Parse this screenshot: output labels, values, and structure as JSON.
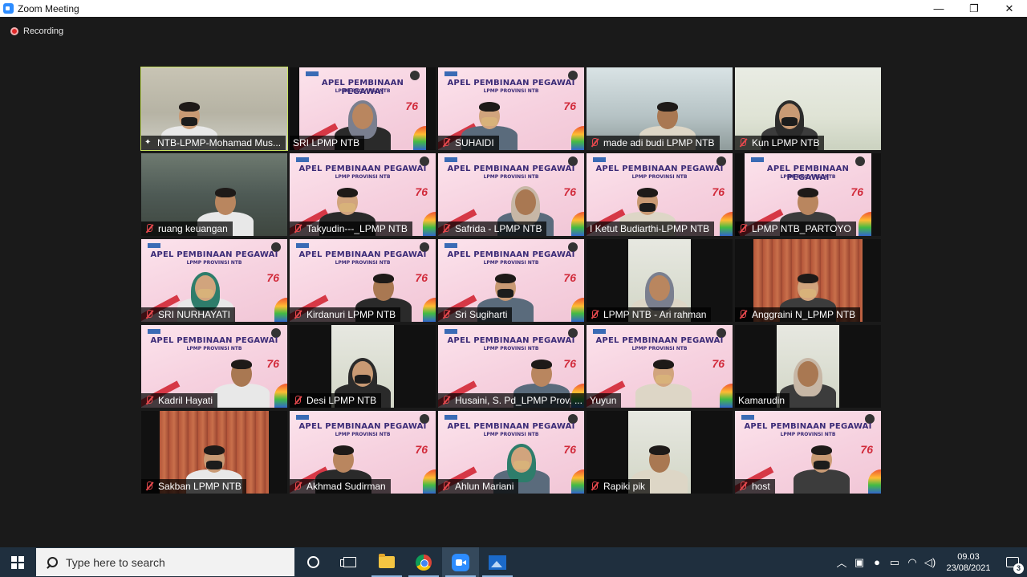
{
  "window": {
    "title": "Zoom Meeting",
    "controls": {
      "minimize": "—",
      "restore": "❐",
      "close": "✕"
    }
  },
  "recording": {
    "label": "Recording"
  },
  "participants": [
    {
      "name": "NTB-LPMP-Mohamad Mus...",
      "muted": false,
      "pinned": true,
      "active": true,
      "bg": "room"
    },
    {
      "name": "SRI LPMP NTB",
      "muted": false,
      "bg": "banner-narrow"
    },
    {
      "name": "SUHAIDI",
      "muted": true,
      "bg": "banner"
    },
    {
      "name": "made adi budi LPMP NTB",
      "muted": true,
      "bg": "window"
    },
    {
      "name": "Kun LPMP NTB",
      "muted": true,
      "bg": "wall-green"
    },
    {
      "name": "ruang keuangan",
      "muted": true,
      "bg": "dark-room"
    },
    {
      "name": "Takyudin---_LPMP NTB",
      "muted": true,
      "bg": "banner"
    },
    {
      "name": "Safrida - LPMP NTB",
      "muted": true,
      "bg": "banner"
    },
    {
      "name": "I Ketut Budiarthi-LPMP NTB",
      "muted": false,
      "bg": "banner"
    },
    {
      "name": "LPMP NTB_PARTOYO",
      "muted": true,
      "bg": "banner-narrow"
    },
    {
      "name": "SRI NURHAYATI",
      "muted": true,
      "bg": "banner"
    },
    {
      "name": "Kirdanuri LPMP NTB",
      "muted": true,
      "bg": "banner"
    },
    {
      "name": "Sri Sugiharti",
      "muted": true,
      "bg": "banner"
    },
    {
      "name": "LPMP NTB - Ari rahman",
      "muted": true,
      "bg": "narrow"
    },
    {
      "name": "Anggraini N_LPMP NTB",
      "muted": true,
      "bg": "curtain-narrow"
    },
    {
      "name": "Kadril Hayati",
      "muted": true,
      "bg": "banner"
    },
    {
      "name": "Desi LPMP NTB",
      "muted": true,
      "bg": "narrow"
    },
    {
      "name": "Husaini, S. Pd_LPMP Prov. ...",
      "muted": true,
      "bg": "banner"
    },
    {
      "name": "Yuyun",
      "muted": false,
      "bg": "banner"
    },
    {
      "name": "Kamarudin",
      "muted": false,
      "bg": "narrow"
    },
    {
      "name": "Sakban LPMP NTB",
      "muted": true,
      "bg": "curtain-narrow"
    },
    {
      "name": "Akhmad Sudirman",
      "muted": true,
      "bg": "banner"
    },
    {
      "name": "Ahlun Mariani",
      "muted": true,
      "bg": "banner"
    },
    {
      "name": "Rapiki pik",
      "muted": true,
      "bg": "narrow"
    },
    {
      "name": "host",
      "muted": true,
      "bg": "banner"
    }
  ],
  "banner": {
    "title": "APEL PEMBINAAN PEGAWAI",
    "subtitle": "LPMP PROVINSI NTB",
    "badge": "76"
  },
  "taskbar": {
    "search_placeholder": "Type here to search",
    "apps": [
      "cortana-icon",
      "task-view-icon",
      "file-explorer-icon",
      "chrome-icon",
      "zoom-icon",
      "photos-icon"
    ],
    "tray_icons": [
      "chevron-up-icon",
      "meet-now-icon",
      "microphone-icon",
      "battery-icon",
      "wifi-icon",
      "volume-icon"
    ],
    "time": "09.03",
    "date": "23/08/2021",
    "notification_count": "3"
  }
}
